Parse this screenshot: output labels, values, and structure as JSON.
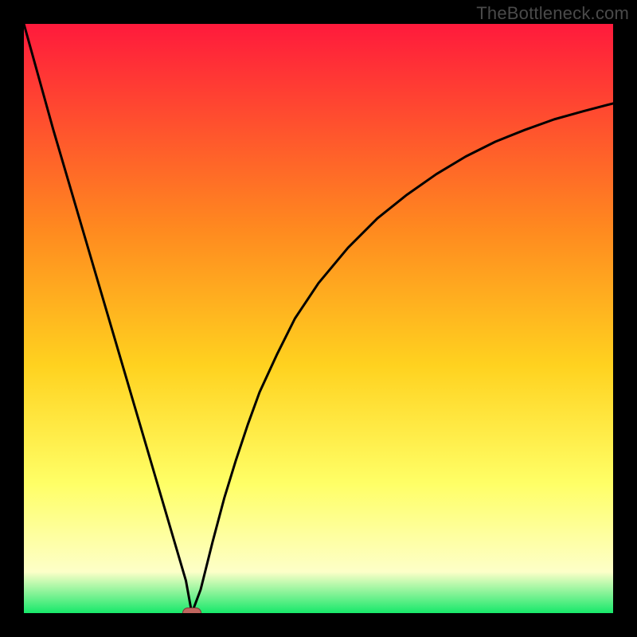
{
  "watermark": "TheBottleneck.com",
  "colors": {
    "frame": "#000000",
    "gradient_top": "#ff1a3c",
    "gradient_mid1": "#ff8a1f",
    "gradient_mid2": "#ffd21f",
    "gradient_mid3": "#ffff66",
    "gradient_mid4": "#fdffc8",
    "gradient_bottom": "#17e86a",
    "curve": "#000000",
    "marker_fill": "#c0655e",
    "marker_stroke": "#7a3b37"
  },
  "chart_data": {
    "type": "line",
    "title": "",
    "xlabel": "",
    "ylabel": "",
    "xlim": [
      0,
      100
    ],
    "ylim": [
      0,
      100
    ],
    "series": [
      {
        "name": "bottleneck-curve",
        "x": [
          0,
          2.5,
          5,
          7.5,
          10,
          12.5,
          15,
          17.5,
          20,
          22.5,
          25,
          27.5,
          28.5,
          30,
          32,
          34,
          36,
          38,
          40,
          43,
          46,
          50,
          55,
          60,
          65,
          70,
          75,
          80,
          85,
          90,
          95,
          100
        ],
        "values": [
          100,
          91,
          82,
          73.5,
          65,
          56.5,
          48,
          39.5,
          31,
          22.5,
          14,
          5.5,
          0,
          4,
          12,
          19.5,
          26,
          32,
          37.5,
          44,
          50,
          56,
          62,
          67,
          71,
          74.5,
          77.5,
          80,
          82,
          83.8,
          85.2,
          86.5
        ]
      }
    ],
    "minimum_marker": {
      "x": 28.5,
      "y": 0
    },
    "grid": false,
    "legend": false
  }
}
